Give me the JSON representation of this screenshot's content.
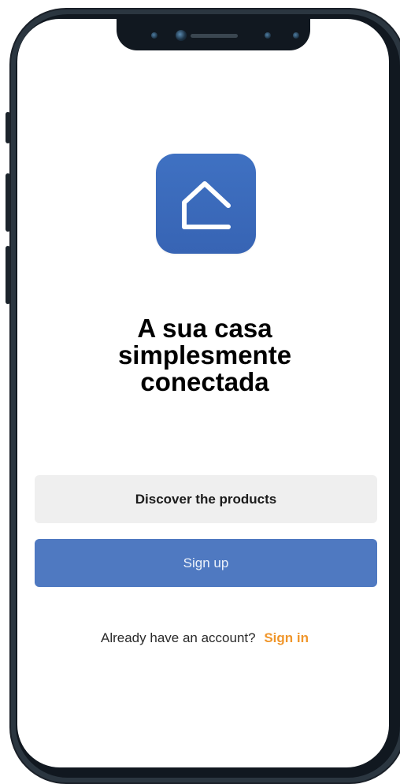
{
  "app": {
    "icon_name": "home-outline-icon",
    "brand_color": "#3f71c2"
  },
  "headline": {
    "line1": "A sua casa",
    "line2": "simplesmente",
    "line3": "conectada"
  },
  "actions": {
    "discover_label": "Discover the products",
    "signup_label": "Sign up"
  },
  "signin": {
    "prompt": "Already have an account?",
    "link_label": "Sign in",
    "link_color": "#f0962b"
  },
  "colors": {
    "signup_bg": "#4f79c1",
    "discover_bg": "#efefef"
  }
}
